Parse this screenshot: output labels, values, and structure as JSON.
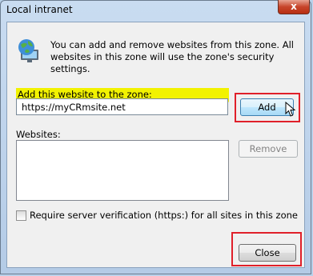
{
  "window": {
    "title": "Local intranet",
    "close_glyph": "x"
  },
  "info": {
    "text": "You can add and remove websites from this zone. All websites in this zone will use the zone's security settings.",
    "icon": "globe-computer-icon"
  },
  "add_section": {
    "label": "Add this website to the zone:",
    "url_value": "https://myCRmsite.net",
    "add_label": "Add"
  },
  "websites": {
    "label": "Websites:",
    "items": [],
    "remove_label": "Remove"
  },
  "verification": {
    "checked": false,
    "label": "Require server verification (https:) for all sites in this zone"
  },
  "footer": {
    "close_label": "Close"
  },
  "colors": {
    "highlight": "#f2f200",
    "annotation_red": "#e0202a",
    "titlebar": "#c9dcf1"
  }
}
